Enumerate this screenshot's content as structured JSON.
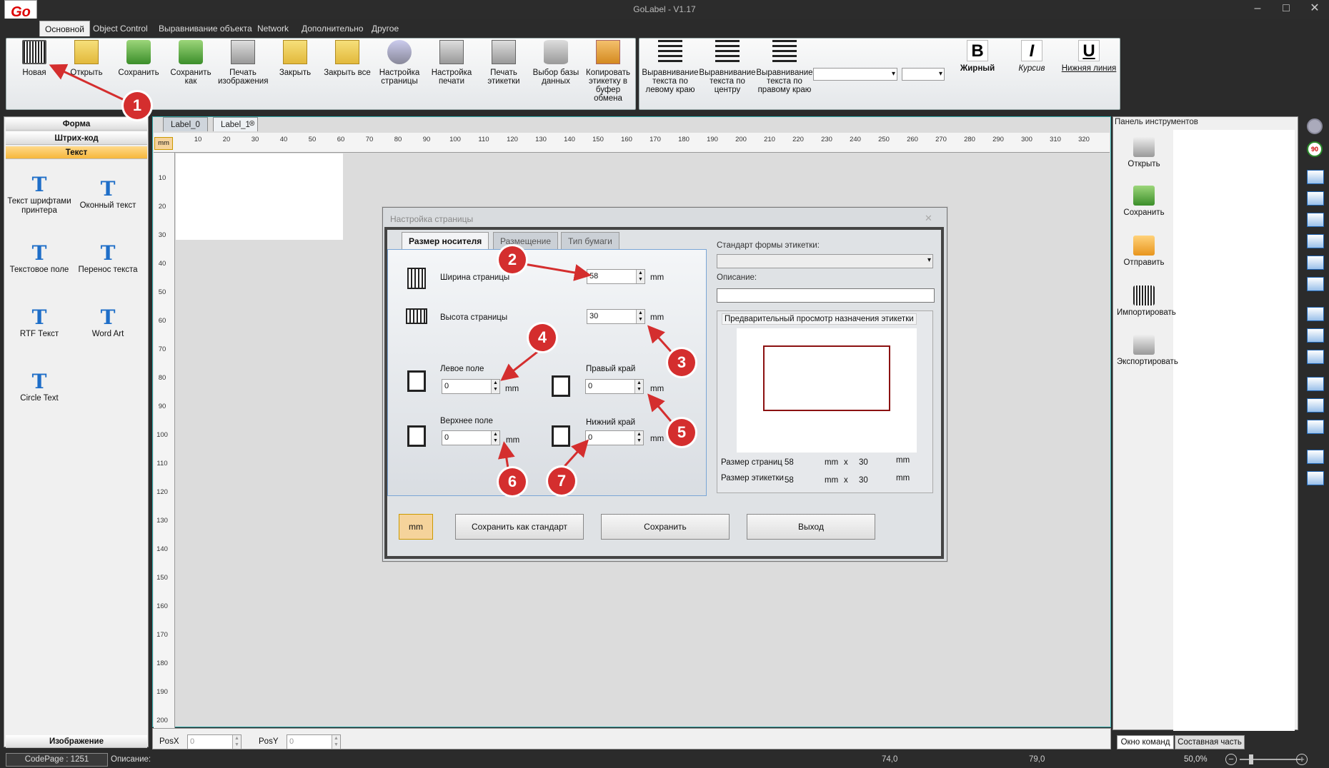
{
  "app": {
    "title": "GoLabel - V1.17",
    "logo": "Go"
  },
  "menu": [
    "Основной",
    "Object Control",
    "Выравнивание объекта",
    "Network",
    "Дополнительно",
    "Другое"
  ],
  "ribbon": {
    "buttons": [
      {
        "label": "Новая",
        "icon": "new-label-icon"
      },
      {
        "label": "Открыть",
        "icon": "open-icon"
      },
      {
        "label": "Сохранить",
        "icon": "save-icon"
      },
      {
        "label": "Сохранить как",
        "icon": "save-as-icon"
      },
      {
        "label": "Печать изображения",
        "icon": "print-image-icon"
      },
      {
        "label": "Закрыть",
        "icon": "close-folder-icon"
      },
      {
        "label": "Закрыть все",
        "icon": "close-all-icon"
      },
      {
        "label": "Настройка страницы",
        "icon": "page-setup-icon"
      },
      {
        "label": "Настройка печати",
        "icon": "print-setup-icon"
      },
      {
        "label": "Печать этикетки",
        "icon": "print-label-icon"
      },
      {
        "label": "Выбор базы данных",
        "icon": "database-icon"
      },
      {
        "label": "Копировать этикетку в буфер обмена",
        "icon": "copy-icon"
      }
    ],
    "align": [
      {
        "label": "Выравнивание текста по левому краю"
      },
      {
        "label": "Выравнивание текста по центру"
      },
      {
        "label": "Выравнивание текста по правому краю"
      }
    ],
    "bold": {
      "glyph": "B",
      "label": "Жирный"
    },
    "italic": {
      "glyph": "I",
      "label": "Курсив"
    },
    "underline": {
      "glyph": "U",
      "label": "Нижняя линия"
    }
  },
  "left": {
    "sections": [
      "Форма",
      "Штрих-код",
      "Текст"
    ],
    "tools": [
      {
        "label": "Текст шрифтами принтера"
      },
      {
        "label": "Оконный текст"
      },
      {
        "label": "Текстовое поле"
      },
      {
        "label": "Перенос текста"
      },
      {
        "label": "RTF Текст"
      },
      {
        "label": "Word Art"
      },
      {
        "label": "Circle Text"
      }
    ],
    "image_section": "Изображение"
  },
  "doc": {
    "tabs": [
      "Label_0",
      "Label_1"
    ],
    "unit": "mm",
    "hticks": [
      "10",
      "20",
      "30",
      "40",
      "50",
      "60",
      "70",
      "80",
      "90",
      "100",
      "110",
      "120",
      "130",
      "140",
      "150",
      "160",
      "170",
      "180",
      "190",
      "200",
      "210",
      "220",
      "230",
      "240",
      "250",
      "260",
      "270",
      "280",
      "290",
      "300",
      "310",
      "320"
    ],
    "vticks": [
      "10",
      "20",
      "30",
      "40",
      "50",
      "60",
      "70",
      "80",
      "90",
      "100",
      "110",
      "120",
      "130",
      "140",
      "150",
      "160",
      "170",
      "180",
      "190",
      "200"
    ],
    "posx_label": "PosX",
    "posx": "0",
    "posy_label": "PosY",
    "posy": "0"
  },
  "dialog": {
    "title": "Настройка страницы",
    "tabs": [
      "Размер носителя",
      "Размещение",
      "Тип бумаги"
    ],
    "width_label": "Ширина страницы",
    "width": "58",
    "height_label": "Высота страницы",
    "height": "30",
    "left_label": "Левое поле",
    "left": "0",
    "right_label": "Правый край",
    "right": "0",
    "top_label": "Верхнее поле",
    "top": "0",
    "bottom_label": "Нижний край",
    "bottom": "0",
    "unit": "mm",
    "standard_label": "Стандарт формы этикетки:",
    "desc_label": "Описание:",
    "preview_title": "Предварительный просмотр назначения этикетки",
    "page_size_label": "Размер страниц",
    "label_size_label": "Размер этикетки",
    "pw": "58",
    "ph": "30",
    "lw": "58",
    "lh": "30",
    "x": "x",
    "buttons": {
      "unit": "mm",
      "save_std": "Сохранить как стандарт",
      "save": "Сохранить",
      "exit": "Выход"
    }
  },
  "right": {
    "title": "Панель инструментов",
    "tools": [
      "Открыть",
      "Сохранить",
      "Отправить",
      "Импортировать",
      "Экспортировать"
    ],
    "bottom_tabs": [
      "Окно команд",
      "Составная часть"
    ]
  },
  "status": {
    "codepage": "CodePage : 1251",
    "desc": "Описание:",
    "v1": "74,0",
    "v2": "79,0",
    "zoom": "50,0%"
  },
  "annotations": [
    "1",
    "2",
    "3",
    "4",
    "5",
    "6",
    "7"
  ],
  "colors": {
    "accent": "#d42e2e",
    "active_section": "#f6b73c"
  }
}
